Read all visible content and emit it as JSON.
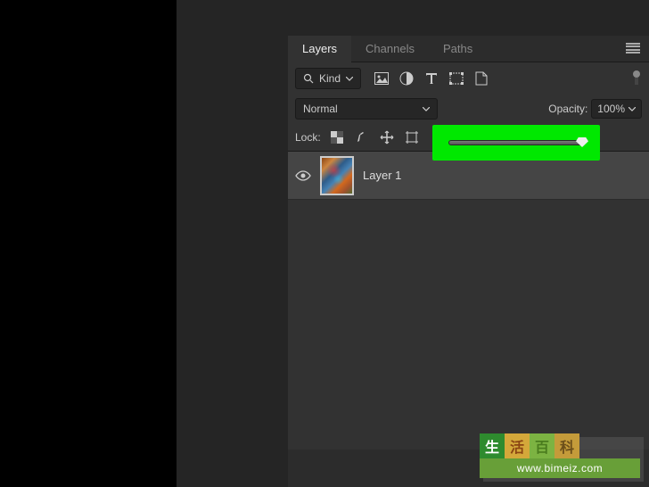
{
  "tabs": {
    "layers": "Layers",
    "channels": "Channels",
    "paths": "Paths"
  },
  "filter": {
    "kind_label": "Kind"
  },
  "blend": {
    "mode": "Normal",
    "opacity_label": "Opacity:",
    "opacity_value": "100%"
  },
  "lock": {
    "label": "Lock:"
  },
  "layers": [
    {
      "name": "Layer 1"
    }
  ],
  "watermark": {
    "chars": [
      "生",
      "活",
      "百",
      "科"
    ],
    "url": "www.bimeiz.com"
  }
}
